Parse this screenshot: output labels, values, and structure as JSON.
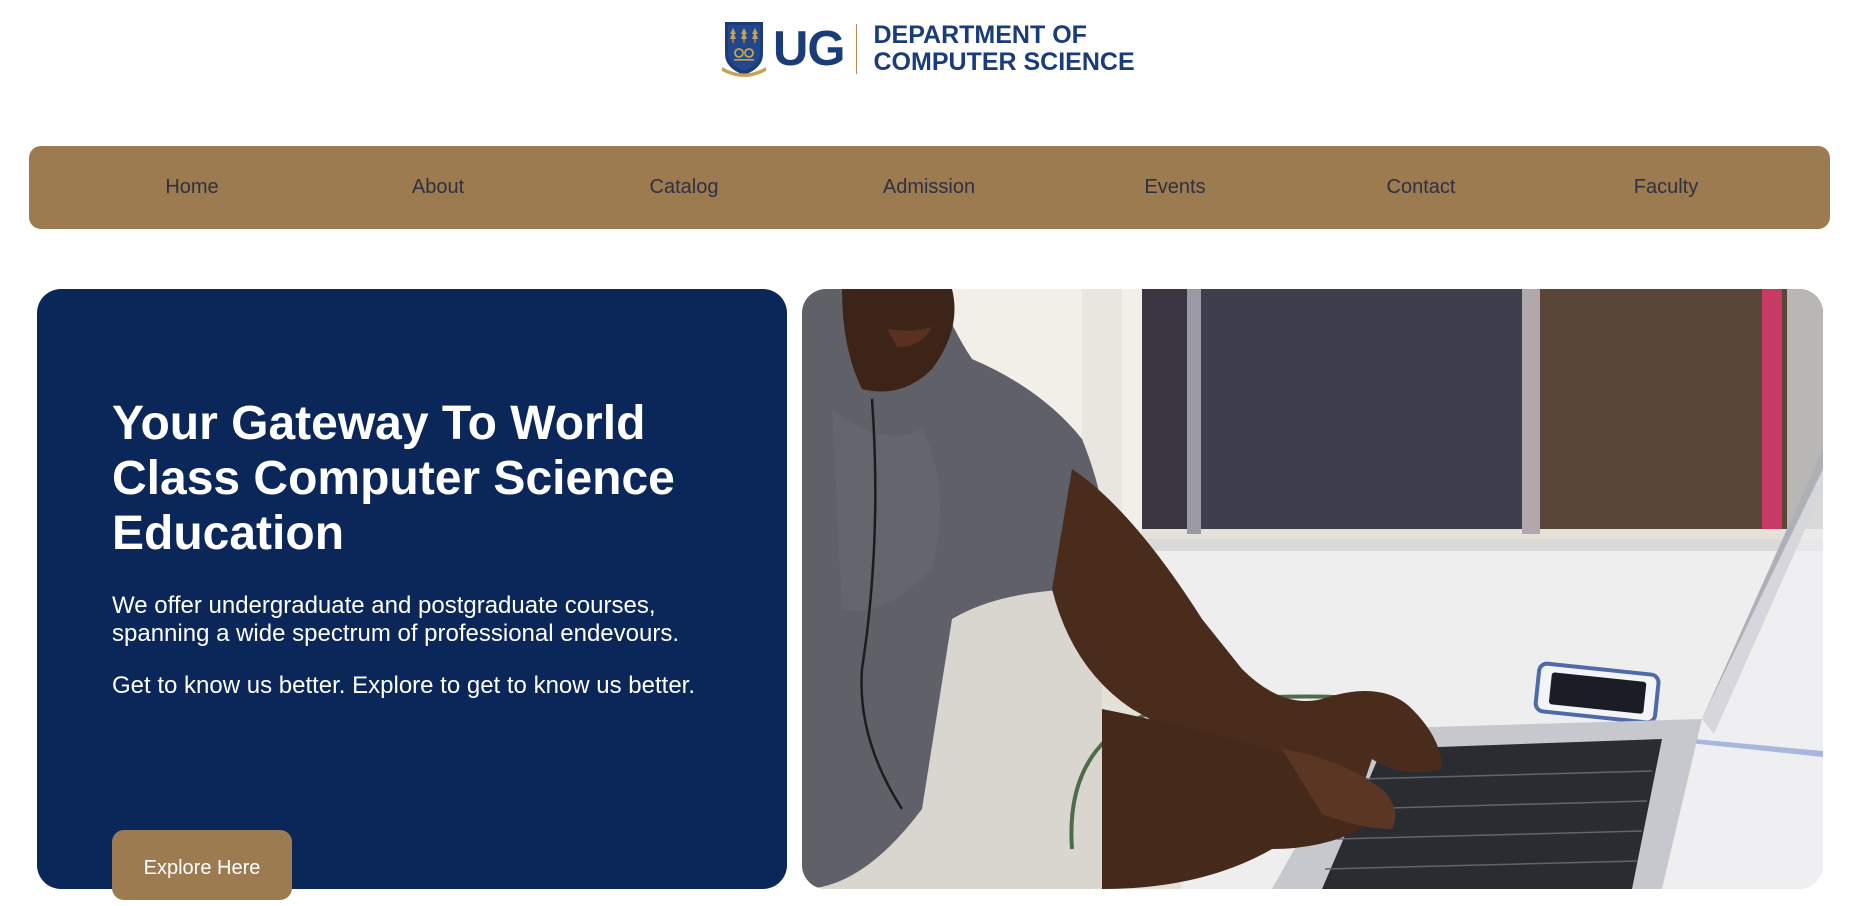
{
  "header": {
    "logo_mark": "UG",
    "department_line1": "DEPARTMENT OF",
    "department_line2": "COMPUTER SCIENCE"
  },
  "nav": {
    "items": [
      {
        "label": "Home"
      },
      {
        "label": "About"
      },
      {
        "label": "Catalog"
      },
      {
        "label": "Admission"
      },
      {
        "label": "Events"
      },
      {
        "label": "Contact"
      },
      {
        "label": "Faculty"
      }
    ]
  },
  "hero": {
    "title": "Your Gateway To World Class Computer Science Education",
    "paragraph1": "We offer undergraduate and postgraduate courses, spanning a wide spectrum of professional endevours.",
    "paragraph2": "Get to know us better. Explore to get to know us better.",
    "button_label": "Explore Here"
  },
  "colors": {
    "brand_blue": "#0b2759",
    "brand_gold": "#9c7b50",
    "logo_blue": "#1a3c78",
    "nav_text": "#2f3040"
  }
}
